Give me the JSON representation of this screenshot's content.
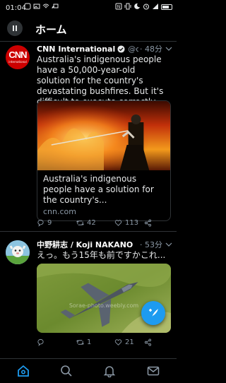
{
  "status_bar": {
    "time": "01:04",
    "icons": [
      "app-notification-icon",
      "image-icon",
      "wifi-icon",
      "cast-icon",
      "nfc-icon",
      "vibrate-icon",
      "do-not-disturb-icon",
      "alarm-icon",
      "signal-icon",
      "battery-icon"
    ]
  },
  "header": {
    "title": "ホーム"
  },
  "tweets": [
    {
      "name": "CNN International",
      "verified": true,
      "handle": "@c...",
      "time": "· 48分",
      "avatar_text": "CNN",
      "avatar_subtext": "international",
      "text": "Australia's indigenous people have a 50,000-year-old solution for the country's devastating bushfires. But it's difficult to execute correctly.",
      "card": {
        "title": "Australia's indigenous people have a solution for the country's...",
        "url": "cnn.com"
      },
      "actions": {
        "replies": "9",
        "retweets": "42",
        "likes": "113"
      }
    },
    {
      "name": "中野耕志 / Koji NAKANO",
      "verified": false,
      "handle": "",
      "time": "· 53分",
      "text": "えっ。もう15年も前ですかこれ...",
      "watermark": "Sorae-photo.weebly.com",
      "actions": {
        "replies": "",
        "retweets": "1",
        "likes": "21"
      }
    }
  ],
  "colors": {
    "accent": "#1d9bf0",
    "background": "#000000",
    "secondary_text": "#8b98a5",
    "cnn_red": "#cc0000",
    "divider": "#2f3336"
  },
  "bottom_nav": [
    "home-icon",
    "search-icon",
    "notifications-icon",
    "messages-icon"
  ]
}
